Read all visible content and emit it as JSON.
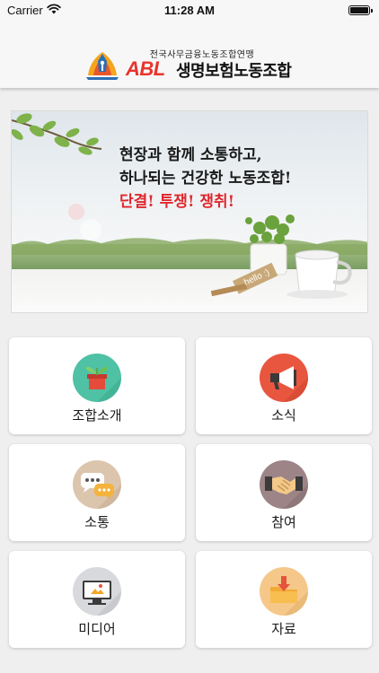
{
  "status_bar": {
    "carrier": "Carrier",
    "time": "11:28 AM"
  },
  "header": {
    "org_subtitle": "전국사무금융노동조합연맹",
    "brand": "ABL",
    "org_name": "생명보험노동조합",
    "brand_color": "#e8342c"
  },
  "banner": {
    "line1": "현장과 함께 소통하고,",
    "line2": "하나되는 건강한 노동조합!",
    "line3": "단결! 투쟁! 쟁취!",
    "sign_text": "hello :)"
  },
  "menu": {
    "items": [
      {
        "label": "조합소개",
        "icon": "plant-pot-icon",
        "color": "#4fc1a5"
      },
      {
        "label": "소식",
        "icon": "megaphone-icon",
        "color": "#e8563f"
      },
      {
        "label": "소통",
        "icon": "chat-bubbles-icon",
        "color": "#dcc5ad"
      },
      {
        "label": "참여",
        "icon": "handshake-icon",
        "color": "#9c8487"
      },
      {
        "label": "미디어",
        "icon": "monitor-icon",
        "color": "#d7d9dc"
      },
      {
        "label": "자료",
        "icon": "folder-download-icon",
        "color": "#f5c88a"
      }
    ]
  }
}
